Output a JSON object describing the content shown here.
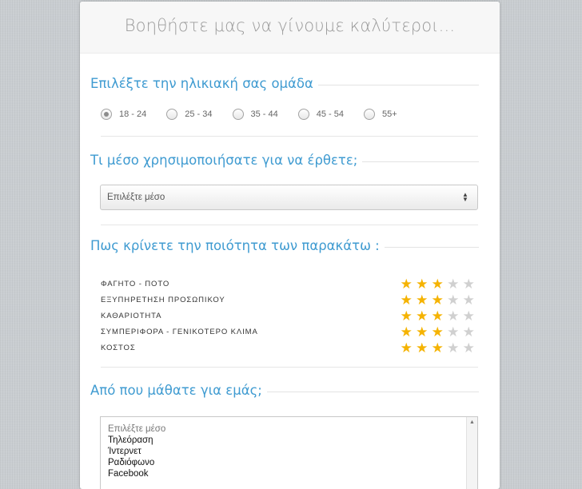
{
  "header": {
    "title": "Βοηθήστε μας να γίνουμε καλύτεροι..."
  },
  "age": {
    "title": "Επιλέξτε την ηλικιακή σας ομάδα",
    "options": [
      "18 - 24",
      "25 - 34",
      "35 - 44",
      "45 - 54",
      "55+"
    ],
    "selected": "18 - 24"
  },
  "transport": {
    "title": "Τι μέσο χρησιμοποιήσατε για να έρθετε;",
    "select_value": "Επιλέξτε μέσο"
  },
  "quality": {
    "title": "Πως κρίνετε την ποιότητα των παρακάτω :",
    "max_stars": 5,
    "items": [
      {
        "label": "ΦΑΓΗΤΟ - ΠΟΤΟ",
        "rating": 3
      },
      {
        "label": "ΕΞΥΠΗΡΕΤΗΣΗ ΠΡΟΣΩΠΙΚΟΥ",
        "rating": 3
      },
      {
        "label": "ΚΑΘΑΡΙΟΤΗΤΑ",
        "rating": 3
      },
      {
        "label": "ΣΥΜΠΕΡΙΦΟΡΑ - ΓΕΝΙΚΟΤΕΡΟ ΚΛΙΜΑ",
        "rating": 3
      },
      {
        "label": "ΚΟΣΤΟΣ",
        "rating": 3
      }
    ]
  },
  "source": {
    "title": "Από που μάθατε για εμάς;",
    "placeholder": "Επιλέξτε μέσο",
    "options": [
      "Τηλεόραση",
      "Ίντερνετ",
      "Ραδιόφωνο",
      "Facebook"
    ]
  },
  "colors": {
    "accent": "#3f9bd1",
    "star_on": "#f5b301",
    "star_off": "#d0d0d0"
  },
  "icons": {
    "star": "star-icon",
    "radio": "radio-icon",
    "select": "updown-arrows-icon"
  }
}
